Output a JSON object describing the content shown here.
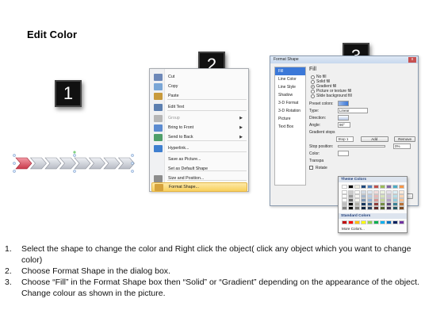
{
  "title": "Edit Color",
  "step_badges": [
    "1",
    "2",
    "3"
  ],
  "colors": {
    "accent": "#3b78d8",
    "menu_highlight": "#f8cf5c",
    "arrow_selected": "#d24b5a",
    "arrow_default": "#c9ccd3"
  },
  "context_menu": {
    "items": [
      {
        "label": "Cut",
        "icon": "scissors-icon",
        "disabled": false,
        "submenu": false
      },
      {
        "label": "Copy",
        "icon": "copy-icon",
        "disabled": false,
        "submenu": false
      },
      {
        "label": "Paste",
        "icon": "paste-icon",
        "disabled": false,
        "submenu": false
      },
      {
        "label": "Edit Text",
        "icon": "edit-text-icon",
        "disabled": false,
        "submenu": false
      },
      {
        "label": "Group",
        "icon": "group-icon",
        "disabled": true,
        "submenu": true
      },
      {
        "label": "Bring to Front",
        "icon": "bring-front-icon",
        "disabled": false,
        "submenu": true
      },
      {
        "label": "Send to Back",
        "icon": "send-back-icon",
        "disabled": false,
        "submenu": true
      },
      {
        "label": "Hyperlink...",
        "icon": "hyperlink-icon",
        "disabled": false,
        "submenu": false
      },
      {
        "label": "Save as Picture...",
        "icon": "",
        "disabled": false,
        "submenu": false
      },
      {
        "label": "Set as Default Shape",
        "icon": "",
        "disabled": false,
        "submenu": false
      },
      {
        "label": "Size and Position...",
        "icon": "size-position-icon",
        "disabled": false,
        "submenu": false
      },
      {
        "label": "Format Shape...",
        "icon": "format-shape-icon",
        "disabled": false,
        "submenu": false,
        "highlighted": true
      }
    ]
  },
  "format_dialog": {
    "title": "Format Shape",
    "close": "x",
    "nav": [
      "Fill",
      "Line Color",
      "Line Style",
      "Shadow",
      "3-D Format",
      "3-D Rotation",
      "Picture",
      "Text Box"
    ],
    "heading": "Fill",
    "fill_options": [
      "No fill",
      "Solid fill",
      "Gradient fill",
      "Picture or texture fill",
      "Slide background fill"
    ],
    "selected_option": "Gradient fill",
    "preset_label": "Preset colors:",
    "type_label": "Type:",
    "type_value": "Linear",
    "direction_label": "Direction:",
    "angle_label": "Angle:",
    "angle_value": "90°",
    "stops_label": "Gradient stops",
    "stop_value": "Stop 1",
    "add_label": "Add",
    "remove_label": "Remove",
    "stop_position_label": "Stop position:",
    "stop_position_value": "0%",
    "color_label": "Color:",
    "transparency_label": "Transpa",
    "rotate_label": "Rotate",
    "close_label": "se"
  },
  "color_dropdown": {
    "theme_header": "Theme Colors",
    "standard_header": "Standard Colors",
    "more": "More Colors...",
    "theme_row": [
      "#ffffff",
      "#000000",
      "#eeece1",
      "#1f497d",
      "#4f81bd",
      "#c0504d",
      "#9bbb59",
      "#8064a2",
      "#4bacc6",
      "#f79646"
    ],
    "standard_row": [
      "#c00000",
      "#ff0000",
      "#ffc000",
      "#ffff00",
      "#92d050",
      "#00b050",
      "#00b0f0",
      "#0070c0",
      "#002060",
      "#7030a0"
    ]
  },
  "instructions": [
    {
      "n": "1.",
      "text": "Select the shape to change the color and Right click the object( click any object which you want to change color)"
    },
    {
      "n": "2.",
      "text": "Choose Format Shape in the dialog box."
    },
    {
      "n": "3.",
      "text": "Choose “Fill” in the Format Shape box then “Solid” or “Gradient” depending on the appearance of the object. Change colour as shown in the picture."
    }
  ]
}
